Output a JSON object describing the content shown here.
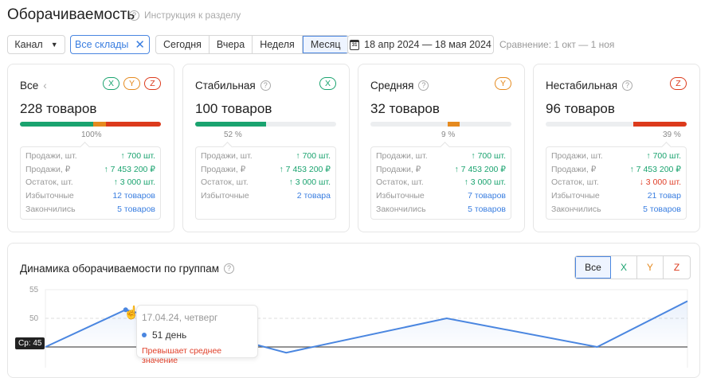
{
  "header": {
    "title": "Оборачиваемость",
    "help_icon": "?",
    "instruction": "Инструкция к разделу"
  },
  "filters": {
    "channel": "Канал",
    "warehouses": "Все склады",
    "periods": [
      "Сегодня",
      "Вчера",
      "Неделя",
      "Месяц"
    ],
    "active_period": "Месяц",
    "date_range": "18 апр 2024 — 18 мая 2024",
    "comparison": "Сравнение: 1 окт — 1 ноя"
  },
  "colors": {
    "x": "#1aa36f",
    "y": "#e58a1f",
    "z": "#dc3a1c",
    "accent": "#4a86e0"
  },
  "cards": [
    {
      "title": "Все",
      "count": "228 товаров",
      "percent": "100%",
      "fill": [
        52,
        9,
        39
      ],
      "badges": [
        "X",
        "Y",
        "Z"
      ],
      "rows": [
        [
          "Продажи, шт.",
          "↑ 700 шт.",
          "up"
        ],
        [
          "Продажи, ₽",
          "↑ 7 453 200 ₽",
          "up"
        ],
        [
          "Остаток, шт.",
          "↑ 3 000 шт.",
          "up"
        ],
        [
          "Избыточные",
          "12 товаров",
          "lk"
        ],
        [
          "Закончились",
          "5 товаров",
          "lk"
        ]
      ]
    },
    {
      "title": "Стабильная",
      "count": "100 товаров",
      "percent": "52 %",
      "fill": 52,
      "badges": [
        "X"
      ],
      "rows": [
        [
          "Продажи, шт.",
          "↑ 700 шт.",
          "up"
        ],
        [
          "Продажи, ₽",
          "↑ 7 453 200 ₽",
          "up"
        ],
        [
          "Остаток, шт.",
          "↑ 3 000 шт.",
          "up"
        ],
        [
          "Избыточные",
          "2 товара",
          "lk"
        ]
      ]
    },
    {
      "title": "Средняя",
      "count": "32 товаров",
      "percent": "9 %",
      "fill": 9,
      "badges": [
        "Y"
      ],
      "rows": [
        [
          "Продажи, шт.",
          "↑ 700 шт.",
          "up"
        ],
        [
          "Продажи, ₽",
          "↑ 7 453 200 ₽",
          "up"
        ],
        [
          "Остаток, шт.",
          "↑ 3 000 шт.",
          "up"
        ],
        [
          "Избыточные",
          "7 товаров",
          "lk"
        ],
        [
          "Закончились",
          "5 товаров",
          "lk"
        ]
      ]
    },
    {
      "title": "Нестабильная",
      "count": "96 товаров",
      "percent": "39 %",
      "fill": 39,
      "badges": [
        "Z"
      ],
      "rows": [
        [
          "Продажи, шт.",
          "↑ 700 шт.",
          "up"
        ],
        [
          "Продажи, ₽",
          "↑ 7 453 200 ₽",
          "up"
        ],
        [
          "Остаток, шт.",
          "↓ 3 000 шт.",
          "dn"
        ],
        [
          "Избыточные",
          "21 товар",
          "lk"
        ],
        [
          "Закончились",
          "5 товаров",
          "lk"
        ]
      ]
    }
  ],
  "chart_section": {
    "title": "Динамика оборачиваемости по группам",
    "filters": [
      "Все",
      "X",
      "Y",
      "Z"
    ],
    "active_filter": "Все"
  },
  "chart_data": {
    "type": "line",
    "x": [
      0,
      4,
      12,
      20,
      27.5,
      32
    ],
    "values": [
      45,
      51.5,
      44,
      50,
      45,
      53
    ],
    "ylim": [
      40,
      55
    ],
    "yticks": [
      55,
      50,
      45
    ],
    "average": 45,
    "average_label": "Ср: 45",
    "grid": true,
    "tooltip": {
      "date": "17.04.24, четверг",
      "value": "51 день",
      "note": "Превышает среднее значение"
    }
  }
}
